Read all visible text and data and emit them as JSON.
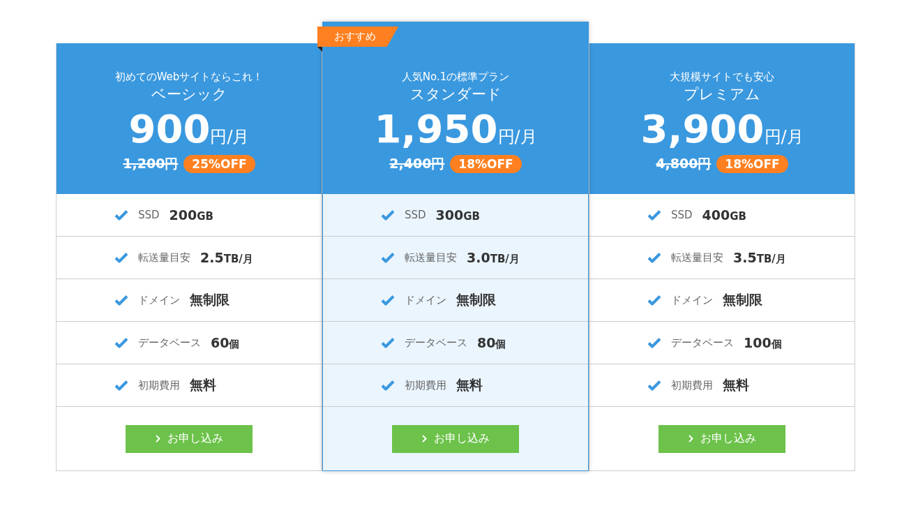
{
  "plans": [
    {
      "featured": false,
      "tagline": "初めてのWebサイトならこれ！",
      "name": "ベーシック",
      "price": "900",
      "price_unit": "円/月",
      "old_price": "1,200円",
      "discount": "25%OFF",
      "features": [
        {
          "label": "SSD",
          "value": "200",
          "unit": "GB"
        },
        {
          "label": "転送量目安",
          "value": "2.5",
          "unit": "TB/月"
        },
        {
          "label": "ドメイン",
          "value": "無制限"
        },
        {
          "label": "データベース",
          "value": "60",
          "unit": "個"
        },
        {
          "label": "初期費用",
          "value": "無料"
        }
      ],
      "button": "お申し込み"
    },
    {
      "featured": true,
      "badge": "おすすめ",
      "tagline": "人気No.1の標準プラン",
      "name": "スタンダード",
      "price": "1,950",
      "price_unit": "円/月",
      "old_price": "2,400円",
      "discount": "18%OFF",
      "features": [
        {
          "label": "SSD",
          "value": "300",
          "unit": "GB"
        },
        {
          "label": "転送量目安",
          "value": "3.0",
          "unit": "TB/月"
        },
        {
          "label": "ドメイン",
          "value": "無制限"
        },
        {
          "label": "データベース",
          "value": "80",
          "unit": "個"
        },
        {
          "label": "初期費用",
          "value": "無料"
        }
      ],
      "button": "お申し込み"
    },
    {
      "featured": false,
      "tagline": "大規模サイトでも安心",
      "name": "プレミアム",
      "price": "3,900",
      "price_unit": "円/月",
      "old_price": "4,800円",
      "discount": "18%OFF",
      "features": [
        {
          "label": "SSD",
          "value": "400",
          "unit": "GB"
        },
        {
          "label": "転送量目安",
          "value": "3.5",
          "unit": "TB/月"
        },
        {
          "label": "ドメイン",
          "value": "無制限"
        },
        {
          "label": "データベース",
          "value": "100",
          "unit": "個"
        },
        {
          "label": "初期費用",
          "value": "無料"
        }
      ],
      "button": "お申し込み"
    }
  ]
}
